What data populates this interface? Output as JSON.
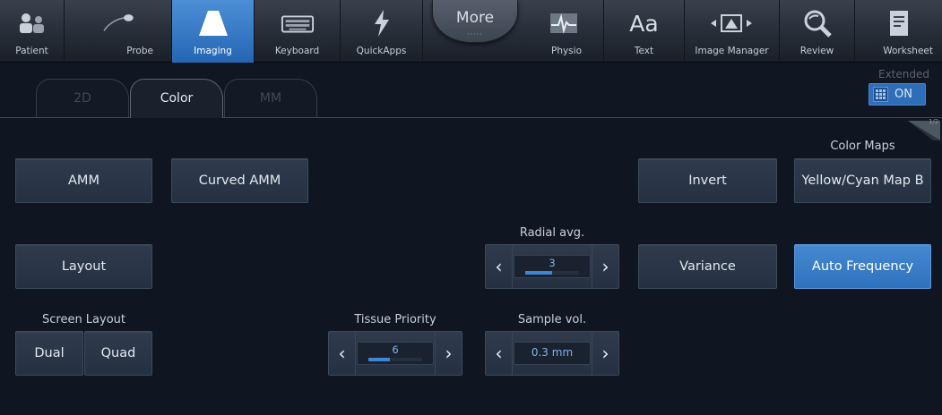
{
  "toolbar": {
    "items": [
      {
        "label": "Patient",
        "icon": "patient-icon"
      },
      {
        "label": "Probe",
        "icon": "probe-icon"
      },
      {
        "label": "Imaging",
        "icon": "imaging-icon",
        "active": true
      },
      {
        "label": "Keyboard",
        "icon": "keyboard-icon"
      },
      {
        "label": "QuickApps",
        "icon": "lightning-icon"
      },
      {
        "label": "Physio",
        "icon": "ecg-icon"
      },
      {
        "label": "Text",
        "icon": "text-icon"
      },
      {
        "label": "Image Manager",
        "icon": "image-manager-icon"
      },
      {
        "label": "Review",
        "icon": "review-icon"
      },
      {
        "label": "Worksheet",
        "icon": "worksheet-icon"
      }
    ],
    "more_label": "More",
    "more_dots": "·····"
  },
  "tabs": {
    "items": [
      {
        "label": "2D",
        "active": false
      },
      {
        "label": "Color",
        "active": true
      },
      {
        "label": "MM",
        "active": false
      }
    ]
  },
  "extended": {
    "label": "Extended",
    "state": "ON"
  },
  "page_indicator": "1/2",
  "buttons": {
    "amm": "AMM",
    "curved_amm": "Curved AMM",
    "invert": "Invert",
    "color_map_value": "Yellow/Cyan Map B",
    "layout": "Layout",
    "variance": "Variance",
    "auto_frequency": "Auto Frequency",
    "dual": "Dual",
    "quad": "Quad"
  },
  "labels": {
    "color_maps": "Color Maps",
    "radial_avg": "Radial avg.",
    "screen_layout": "Screen Layout",
    "tissue_priority": "Tissue Priority",
    "sample_vol": "Sample vol."
  },
  "steppers": {
    "radial_avg": {
      "value": "3",
      "level": 0.5
    },
    "tissue_priority": {
      "value": "6",
      "level": 0.4
    },
    "sample_vol": {
      "value": "0.3 mm"
    }
  },
  "colors": {
    "accent_blue": "#3a7fcb",
    "background": "#0f1622",
    "button": "#2a3647"
  }
}
